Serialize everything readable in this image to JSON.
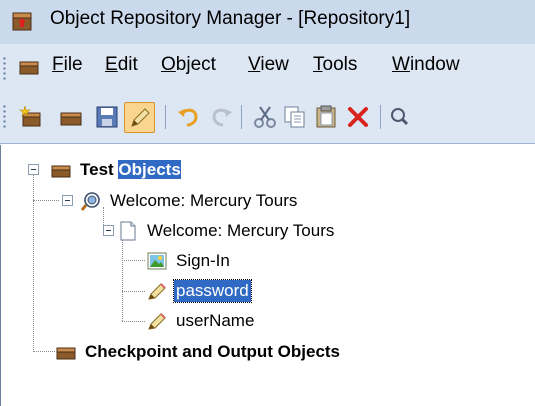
{
  "window": {
    "title": "Object Repository Manager - [Repository1]",
    "title_icon": "repository-app-icon"
  },
  "menu": {
    "items": [
      {
        "label": "File"
      },
      {
        "label": "Edit"
      },
      {
        "label": "Object"
      },
      {
        "label": "View"
      },
      {
        "label": "Tools"
      },
      {
        "label": "Window"
      }
    ]
  },
  "toolbar": {
    "buttons": [
      {
        "name": "new-repository-icon"
      },
      {
        "name": "open-repository-icon"
      },
      {
        "name": "save-icon"
      },
      {
        "name": "highlight-edit-icon",
        "active": true
      },
      {
        "name": "undo-icon"
      },
      {
        "name": "redo-icon"
      },
      {
        "name": "cut-icon"
      },
      {
        "name": "copy-icon"
      },
      {
        "name": "paste-icon"
      },
      {
        "name": "delete-icon"
      },
      {
        "name": "find-icon"
      }
    ]
  },
  "tree": {
    "root": {
      "label_a": "Test ",
      "label_b": "Objects"
    },
    "browser": {
      "label": "Welcome: Mercury Tours"
    },
    "page": {
      "label": "Welcome: Mercury Tours"
    },
    "children": [
      {
        "label": "Sign-In",
        "icon": "image-icon"
      },
      {
        "label": "password",
        "icon": "edit-field-icon",
        "selected": true
      },
      {
        "label": "userName",
        "icon": "edit-field-icon"
      }
    ],
    "checkpoints": {
      "label": "Checkpoint and Output Objects"
    }
  },
  "colors": {
    "titlebar": "#cbd9ec",
    "menubar": "#dde7f4",
    "selection": "#316ac5"
  }
}
